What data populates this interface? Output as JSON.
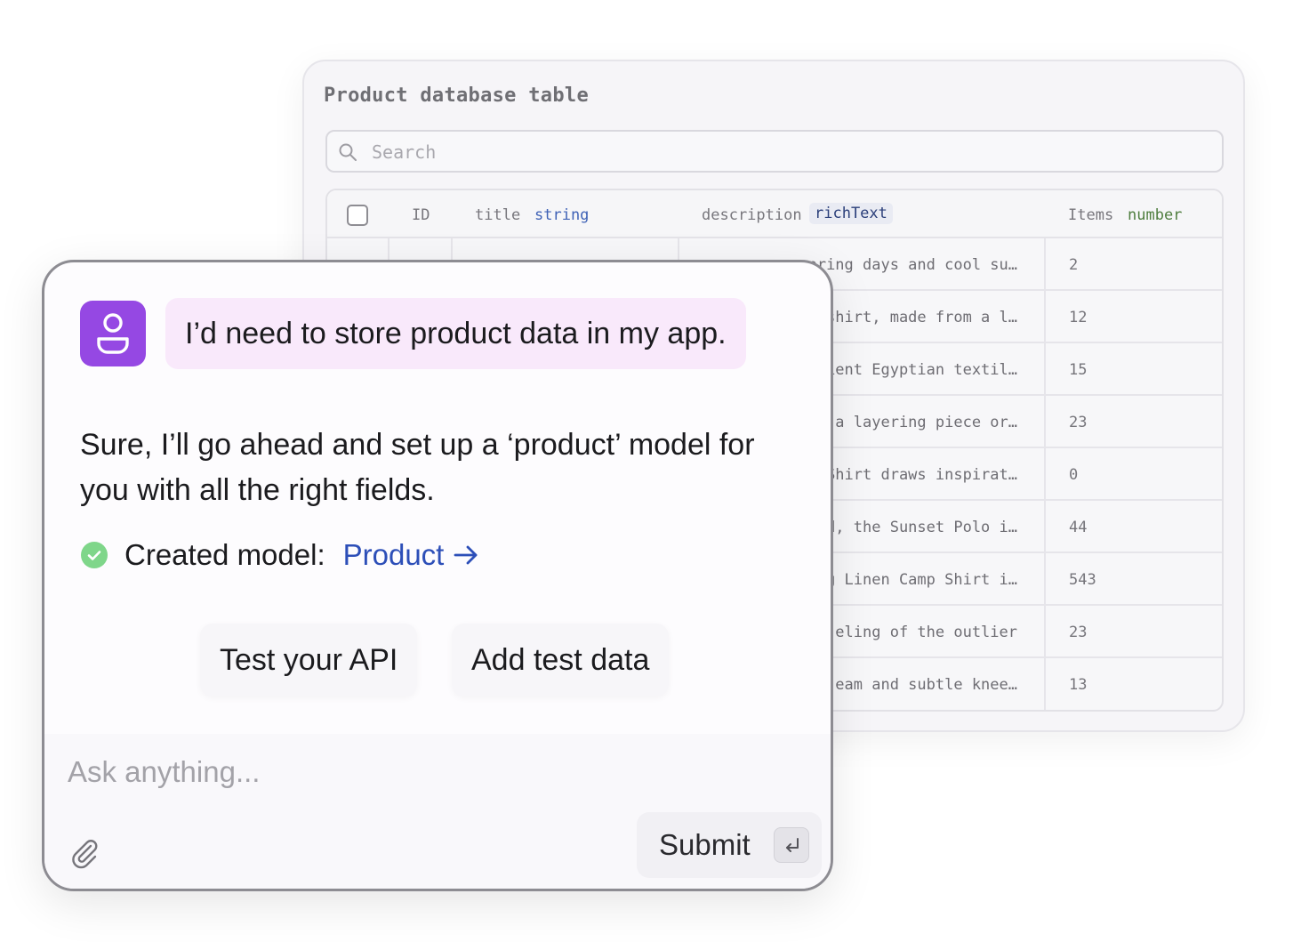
{
  "db_panel": {
    "title": "Product database table",
    "search_placeholder": "Search",
    "columns": {
      "id": "ID",
      "title": "title",
      "title_type": "string",
      "description": "description",
      "description_type": "richText",
      "items": "Items",
      "items_type": "number"
    },
    "rows": [
      {
        "description": "pring days and cool su…",
        "items": "2"
      },
      {
        "description": "shirt, made from a l…",
        "items": "12"
      },
      {
        "description": "ient Egyptian textil…",
        "items": "15"
      },
      {
        "description": "a layering piece or…",
        "items": "23"
      },
      {
        "description": "Shirt draws inspirat…",
        "items": "0"
      },
      {
        "description": "d, the Sunset Polo i…",
        "items": "44"
      },
      {
        "description": "g Linen Camp Shirt i…",
        "items": "543"
      },
      {
        "description": "eling of the outlier",
        "items": "23"
      },
      {
        "description": "eam and subtle knee…",
        "items": "13"
      }
    ]
  },
  "chat": {
    "user_message": "I’d need to store product data in my app.",
    "assistant_message": "Sure, I’ll go ahead and set up a ‘product’ model for you with all the right fields.",
    "created_label": "Created model:",
    "model_link": "Product",
    "actions": {
      "test_api": "Test your API",
      "add_test_data": "Add test data"
    },
    "composer": {
      "placeholder": "Ask anything...",
      "submit_label": "Submit"
    }
  },
  "colors": {
    "avatar": "#9548e3",
    "user_bubble": "#f9e9fb",
    "link": "#2d4fb8",
    "success": "#7fd68a"
  },
  "icons": [
    "search-icon",
    "user-icon",
    "check-circle-icon",
    "arrow-right-icon",
    "paperclip-icon",
    "enter-key-icon"
  ]
}
